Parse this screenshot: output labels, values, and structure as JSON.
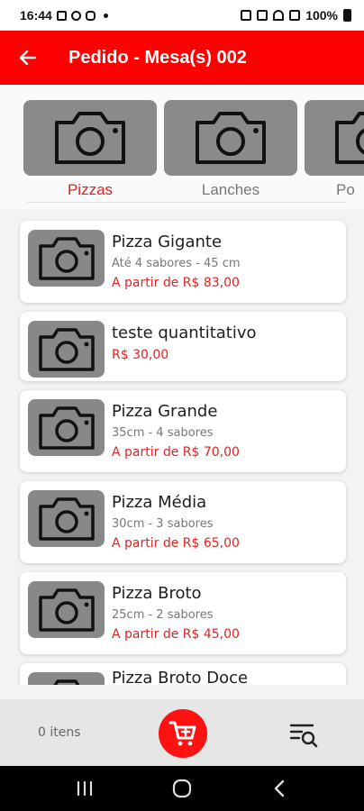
{
  "status_bar": {
    "time": "16:44",
    "battery": "100%"
  },
  "header": {
    "title": "Pedido - Mesa(s) 002"
  },
  "categories": [
    {
      "label": "Pizzas",
      "active": true
    },
    {
      "label": "Lanches",
      "active": false
    },
    {
      "label": "Po",
      "active": false
    }
  ],
  "products": [
    {
      "name": "Pizza Gigante",
      "description": "Até 4 sabores - 45 cm",
      "price": "A partir de R$ 83,00"
    },
    {
      "name": "teste quantitativo",
      "description": "",
      "price": "R$ 30,00"
    },
    {
      "name": "Pizza Grande",
      "description": "35cm - 4 sabores",
      "price": "A partir de R$ 70,00"
    },
    {
      "name": "Pizza Média",
      "description": "30cm - 3 sabores",
      "price": "A partir de R$ 65,00"
    },
    {
      "name": "Pizza Broto",
      "description": "25cm - 2 sabores",
      "price": "A partir de R$ 45,00"
    },
    {
      "name": "Pizza Broto Doce",
      "description": "",
      "price": ""
    }
  ],
  "bottom_bar": {
    "items_count": "0 itens"
  },
  "colors": {
    "primary": "#ff0000",
    "price": "#e32222",
    "image_placeholder": "#888888"
  },
  "icons": {
    "back": "arrow-left-icon",
    "placeholder": "camera-icon",
    "cart": "cart-add-icon",
    "search": "filter-search-icon"
  }
}
